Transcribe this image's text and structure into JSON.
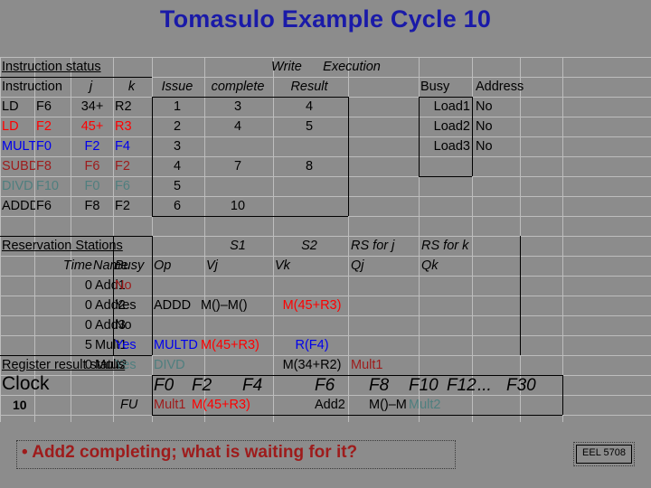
{
  "slide": {
    "title": "Tomasulo Example Cycle 10",
    "footer_bullet": "• Add2 completing; what is waiting for it?",
    "course_badge": "EEL 5708"
  },
  "instruction_status": {
    "section_label": "Instruction status",
    "group_headers": {
      "execution": "Execution",
      "write": "Write"
    },
    "headers": {
      "instruction": "Instruction",
      "j": "j",
      "k": "k",
      "issue": "Issue",
      "complete": "complete",
      "result": "Result"
    },
    "rows": [
      {
        "op": "LD",
        "j": "F6",
        "k2": "34+",
        "k": "R2",
        "issue": "1",
        "complete": "3",
        "result": "4",
        "color": "c-black"
      },
      {
        "op": "LD",
        "j": "F2",
        "k2": "45+",
        "k": "R3",
        "issue": "2",
        "complete": "4",
        "result": "5",
        "color": "c-red"
      },
      {
        "op": "MULTD",
        "j": "F0",
        "k2": "F2",
        "k": "F4",
        "issue": "3",
        "complete": "",
        "result": "",
        "color": "c-blue"
      },
      {
        "op": "SUBD",
        "j": "F8",
        "k2": "F6",
        "k": "F2",
        "issue": "4",
        "complete": "7",
        "result": "8",
        "color": "c-dred"
      },
      {
        "op": "DIVD",
        "j": "F10",
        "k2": "F0",
        "k": "F6",
        "issue": "5",
        "complete": "",
        "result": "",
        "color": "c-teal"
      },
      {
        "op": "ADDD",
        "j": "F6",
        "k2": "F8",
        "k": "F2",
        "issue": "6",
        "complete": "10",
        "result": "",
        "color": "c-black"
      }
    ]
  },
  "load_buffers": {
    "headers": {
      "busy": "Busy",
      "address": "Address"
    },
    "rows": [
      {
        "name": "Load1",
        "busy": "No",
        "address": ""
      },
      {
        "name": "Load2",
        "busy": "No",
        "address": ""
      },
      {
        "name": "Load3",
        "busy": "No",
        "address": ""
      }
    ]
  },
  "reservation_stations": {
    "section_label": "Reservation Stations",
    "group_headers": {
      "s1": "S1",
      "s2": "S2",
      "rs_j": "RS for j",
      "rs_k": "RS for k"
    },
    "headers": {
      "time": "Time",
      "name": "Name",
      "busy": "Busy",
      "op": "Op",
      "vj": "Vj",
      "vk": "Vk",
      "qj": "Qj",
      "qk": "Qk"
    },
    "rows": [
      {
        "time": "0",
        "name": "Add1",
        "busy": "No",
        "busy_color": "c-dred",
        "op": "",
        "op_color": "c-black",
        "vj": "",
        "vj_color": "c-black",
        "vk": "",
        "vk_color": "c-black",
        "qj": "",
        "qj_color": "c-black",
        "qk": "",
        "qk_color": "c-black"
      },
      {
        "time": "0",
        "name": "Add2",
        "busy": "Yes",
        "busy_color": "c-black",
        "op": "ADDD",
        "op_color": "c-black",
        "vj": "M()–M()",
        "vj_color": "c-black",
        "vk": "M(45+R3)",
        "vk_color": "c-red",
        "qj": "",
        "qj_color": "c-black",
        "qk": "",
        "qk_color": "c-black"
      },
      {
        "time": "0",
        "name": "Add3",
        "busy": "No",
        "busy_color": "c-black",
        "op": "",
        "op_color": "c-black",
        "vj": "",
        "vj_color": "c-black",
        "vk": "",
        "vk_color": "c-black",
        "qj": "",
        "qj_color": "c-black",
        "qk": "",
        "qk_color": "c-black"
      },
      {
        "time": "5",
        "name": "Mult1",
        "busy": "Yes",
        "busy_color": "c-blue",
        "op": "MULTD",
        "op_color": "c-blue",
        "vj": "M(45+R3)",
        "vj_color": "c-red",
        "vk": "R(F4)",
        "vk_color": "c-blue",
        "qj": "",
        "qj_color": "c-black",
        "qk": "",
        "qk_color": "c-black"
      },
      {
        "time": "0",
        "name": "Mult2",
        "busy": "Yes",
        "busy_color": "c-teal",
        "op": "DIVD",
        "op_color": "c-teal",
        "vj": "",
        "vj_color": "c-black",
        "vk": "M(34+R2)",
        "vk_color": "c-black",
        "qj": "Mult1",
        "qj_color": "c-dred",
        "qk": "",
        "qk_color": "c-black"
      }
    ]
  },
  "register_result_status": {
    "section_label": "Register result status",
    "clock_label": "Clock",
    "clock_value": "10",
    "fu_label": "FU",
    "registers": [
      "F0",
      "F2",
      "F4",
      "F6",
      "F8",
      "F10",
      "F12",
      "...",
      "F30"
    ],
    "values": [
      {
        "text": "Mult1",
        "color": "c-dred"
      },
      {
        "text": "M(45+R3)",
        "color": "c-red"
      },
      {
        "text": "",
        "color": "c-black"
      },
      {
        "text": "Add2",
        "color": "c-black"
      },
      {
        "text": "M()–M",
        "color": "c-black"
      },
      {
        "text": "Mult2",
        "color": "c-teal"
      },
      {
        "text": "",
        "color": "c-black"
      },
      {
        "text": "",
        "color": "c-black"
      },
      {
        "text": "",
        "color": "c-black"
      }
    ]
  },
  "colors": {
    "background": "#8c8c8c",
    "gridline": "#bdbdbd",
    "title": "#1a1aa8",
    "accent_red": "#ff0000",
    "accent_blue": "#0000ee",
    "accent_dark_red": "#9e1b1b",
    "accent_teal": "#4f7f7f"
  }
}
